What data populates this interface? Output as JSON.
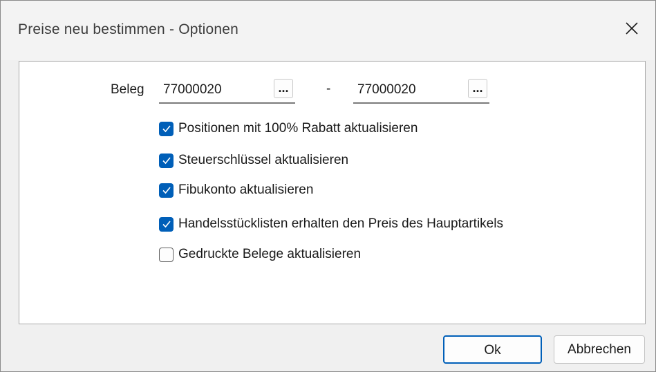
{
  "window": {
    "title": "Preise neu bestimmen - Optionen",
    "close_icon": "close-icon"
  },
  "beleg": {
    "label": "Beleg",
    "from_value": "77000020",
    "to_value": "77000020",
    "separator": "-",
    "browse_label": "..."
  },
  "options": [
    {
      "label": "Positionen mit 100% Rabatt aktualisieren",
      "checked": true
    },
    {
      "label": "Steuerschlüssel aktualisieren",
      "checked": true
    },
    {
      "label": "Fibukonto aktualisieren",
      "checked": true
    },
    {
      "label": "Handelsstücklisten erhalten den Preis des Hauptartikels",
      "checked": true
    },
    {
      "label": "Gedruckte Belege aktualisieren",
      "checked": false
    }
  ],
  "buttons": {
    "ok": "Ok",
    "cancel": "Abbrechen"
  },
  "colors": {
    "accent": "#005fb8",
    "window_bg": "#f0f0f0",
    "panel_bg": "#ffffff"
  }
}
